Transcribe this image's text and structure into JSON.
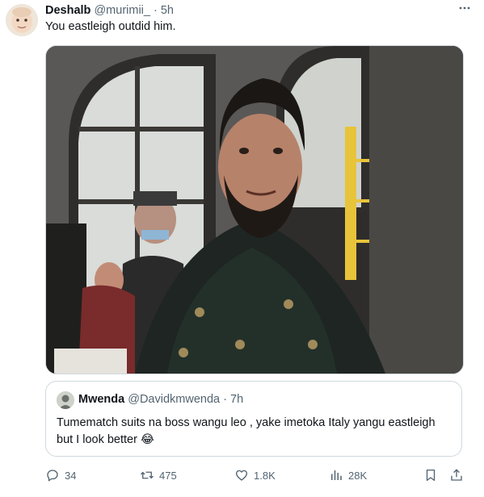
{
  "tweet": {
    "author_name": "Deshalb",
    "author_handle": "@murimii_",
    "separator": "·",
    "time": "5h",
    "text": "You eastleigh outdid him."
  },
  "media": {
    "alt_icon": "image-placeholder"
  },
  "quoted_tweet": {
    "author_name": "Mwenda",
    "author_handle": "@Davidkmwenda",
    "separator": "·",
    "time": "7h",
    "text": "Tumematch suits na boss wangu leo , yake imetoka Italy yangu eastleigh but I look better 😂"
  },
  "actions": {
    "replies": "34",
    "retweets": "475",
    "likes": "1.8K",
    "views": "28K"
  },
  "colors": {
    "text_primary": "#0f1419",
    "text_secondary": "#536471",
    "border": "#cfd9de"
  }
}
